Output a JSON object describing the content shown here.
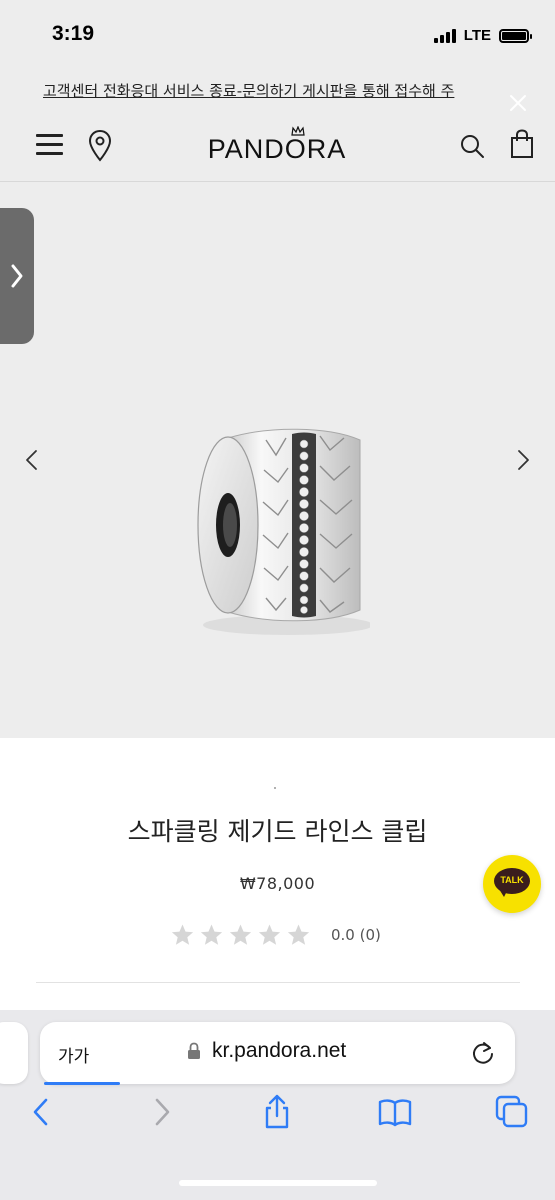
{
  "status_bar": {
    "time": "3:19",
    "network": "LTE",
    "signal_bars": 4,
    "battery_level": 1.0
  },
  "banner": {
    "text": "고객센터 전화응대 서비스 종료-문의하기 게시판을 통해 접수해 주"
  },
  "header": {
    "logo": "PANDORA"
  },
  "product": {
    "title": "스파클링 제기드 라인스 클립",
    "price": "₩78,000",
    "rating_value": 0.0,
    "rating_text": "0.0 (0)",
    "stars_total": 5
  },
  "talk_button": {
    "label": "TALK"
  },
  "safari": {
    "text_size_label": "가가",
    "url": "kr.pandora.net",
    "load_progress": 0.16
  },
  "colors": {
    "background_gray": "#ededed",
    "talk_yellow": "#f7e100",
    "link_blue": "#2f7cf6",
    "star_gray": "#d6d6d6"
  },
  "icons": [
    "menu-icon",
    "location-pin-icon",
    "search-icon",
    "shopping-bag-icon",
    "close-icon",
    "chevron-left-icon",
    "chevron-right-icon",
    "star-icon",
    "lock-icon",
    "reload-icon",
    "back-icon",
    "forward-icon",
    "share-icon",
    "bookmarks-icon",
    "tabs-icon"
  ]
}
